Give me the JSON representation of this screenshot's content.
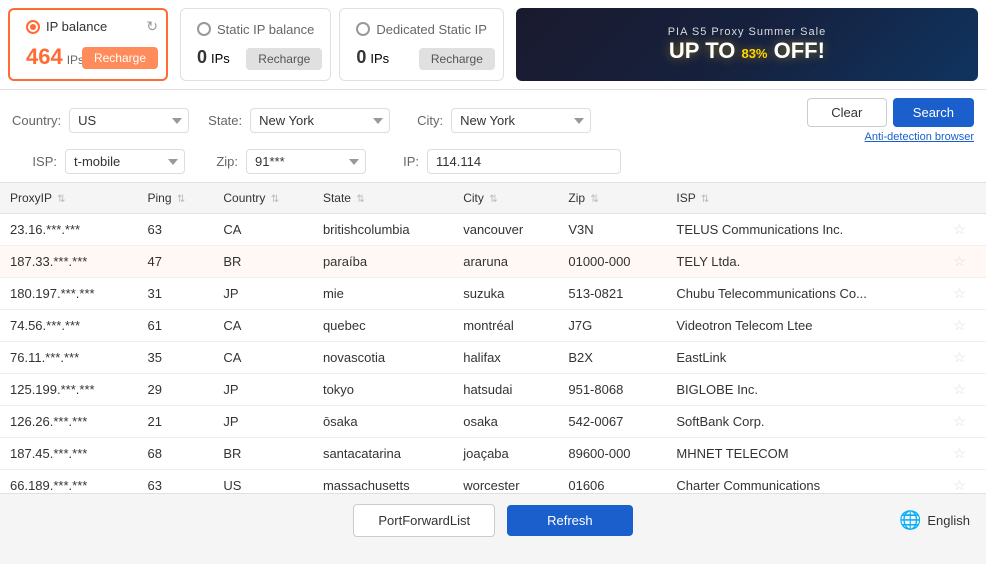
{
  "header": {
    "ip_balance": {
      "label": "IP balance",
      "count": "464",
      "unit": "IPs",
      "recharge_label": "Recharge",
      "active": true
    },
    "static_ip_balance": {
      "label": "Static IP balance",
      "count": "0",
      "unit": "IPs",
      "recharge_label": "Recharge",
      "active": false
    },
    "dedicated_static_ip": {
      "label": "Dedicated Static IP",
      "count": "0",
      "unit": "IPs",
      "recharge_label": "Recharge",
      "active": false
    },
    "ad": {
      "top_text": "PIA S5 Proxy Summer Sale",
      "main_text": "UP TO 83% OFF!",
      "percent": "83%"
    }
  },
  "filters": {
    "country_label": "Country:",
    "country_value": "US",
    "state_label": "State:",
    "state_value": "New York",
    "city_label": "City:",
    "city_value": "New York",
    "isp_label": "ISP:",
    "isp_value": "t-mobile",
    "zip_label": "Zip:",
    "zip_value": "91***",
    "ip_label": "IP:",
    "ip_value": "114.114",
    "clear_label": "Clear",
    "search_label": "Search",
    "anti_detection_label": "Anti-detection browser"
  },
  "table": {
    "columns": [
      {
        "id": "proxyip",
        "label": "ProxyIP"
      },
      {
        "id": "ping",
        "label": "Ping"
      },
      {
        "id": "country",
        "label": "Country"
      },
      {
        "id": "state",
        "label": "State"
      },
      {
        "id": "city",
        "label": "City"
      },
      {
        "id": "zip",
        "label": "Zip"
      },
      {
        "id": "isp",
        "label": "ISP"
      },
      {
        "id": "action",
        "label": ""
      }
    ],
    "rows": [
      {
        "proxyip": "23.16.***.***",
        "ping": "63",
        "country": "CA",
        "state": "britishcolumbia",
        "city": "vancouver",
        "zip": "V3N",
        "isp": "TELUS Communications Inc.",
        "highlight": false
      },
      {
        "proxyip": "187.33.***.***",
        "ping": "47",
        "country": "BR",
        "state": "paraíba",
        "city": "araruna",
        "zip": "01000-000",
        "isp": "TELY Ltda.",
        "highlight": true
      },
      {
        "proxyip": "180.197.***.***",
        "ping": "31",
        "country": "JP",
        "state": "mie",
        "city": "suzuka",
        "zip": "513-0821",
        "isp": "Chubu Telecommunications Co...",
        "highlight": false
      },
      {
        "proxyip": "74.56.***.***",
        "ping": "61",
        "country": "CA",
        "state": "quebec",
        "city": "montréal",
        "zip": "J7G",
        "isp": "Videotron Telecom Ltee",
        "highlight": false
      },
      {
        "proxyip": "76.11.***.***",
        "ping": "35",
        "country": "CA",
        "state": "novascotia",
        "city": "halifax",
        "zip": "B2X",
        "isp": "EastLink",
        "highlight": false
      },
      {
        "proxyip": "125.199.***.***",
        "ping": "29",
        "country": "JP",
        "state": "tokyo",
        "city": "hatsudai",
        "zip": "951-8068",
        "isp": "BIGLOBE Inc.",
        "highlight": false
      },
      {
        "proxyip": "126.26.***.***",
        "ping": "21",
        "country": "JP",
        "state": "ōsaka",
        "city": "osaka",
        "zip": "542-0067",
        "isp": "SoftBank Corp.",
        "highlight": false
      },
      {
        "proxyip": "187.45.***.***",
        "ping": "68",
        "country": "BR",
        "state": "santacatarina",
        "city": "joaçaba",
        "zip": "89600-000",
        "isp": "MHNET TELECOM",
        "highlight": false
      },
      {
        "proxyip": "66.189.***.***",
        "ping": "63",
        "country": "US",
        "state": "massachusetts",
        "city": "worcester",
        "zip": "01606",
        "isp": "Charter Communications",
        "highlight": false
      }
    ]
  },
  "footer": {
    "portforward_label": "PortForwardList",
    "refresh_label": "Refresh",
    "language": "English"
  }
}
